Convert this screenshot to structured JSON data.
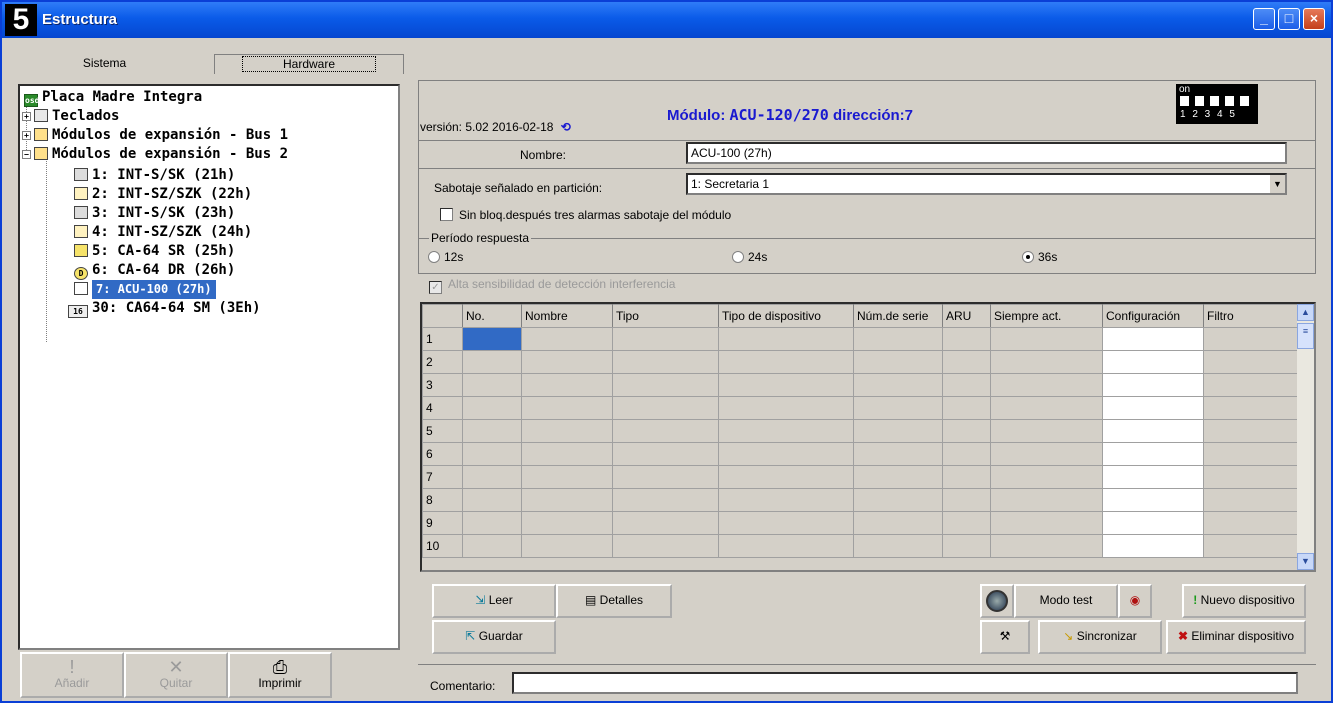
{
  "window": {
    "app_number": "5",
    "title": "Estructura",
    "minimize": "_",
    "maximize": "□",
    "close": "×"
  },
  "tabs": [
    {
      "label": "Sistema"
    },
    {
      "label": "Hardware"
    }
  ],
  "tree": {
    "root": "Placa Madre Integra",
    "root_icon_text": "osd",
    "items": [
      {
        "label": "Teclados",
        "pm": "+"
      },
      {
        "label": "Módulos de expansión - Bus 1",
        "pm": "+"
      },
      {
        "label": "Módulos de expansión - Bus 2",
        "pm": "−"
      }
    ],
    "bus2_children": [
      {
        "label": "1: INT-S/SK (21h)"
      },
      {
        "label": "2: INT-SZ/SZK (22h)"
      },
      {
        "label": "3: INT-S/SK (23h)"
      },
      {
        "label": "4: INT-SZ/SZK (24h)"
      },
      {
        "label": "5: CA-64 SR (25h)"
      },
      {
        "label": "6: CA-64 DR (26h)"
      },
      {
        "label": "7: ACU-100 (27h)"
      },
      {
        "label": "30: CA64-64 SM (3Eh)"
      }
    ],
    "icon_d": "D",
    "icon_16": "16"
  },
  "left_buttons": {
    "add": "Añadir",
    "remove": "Quitar",
    "print": "Imprimir"
  },
  "module": {
    "version": "versión: 5.02 2016-02-18",
    "heading_prefix": "Módulo:",
    "model": "ACU-120/270",
    "address": "dirección:7",
    "dip_on": "on",
    "dip_numbers": "1 2 3 4 5"
  },
  "form": {
    "name_label": "Nombre:",
    "name_value": "ACU-100 (27h)",
    "tamper_label": "Sabotaje señalado en partición:",
    "tamper_value": "1: Secretaria 1",
    "no_lock_label": "Sin bloq.después tres alarmas sabotaje del módulo",
    "period_label": "Período respuesta",
    "period_options": [
      {
        "label": "12s",
        "checked": false
      },
      {
        "label": "24s",
        "checked": false
      },
      {
        "label": "36s",
        "checked": true
      }
    ],
    "high_sensitivity_label": "Alta sensibilidad de detección interferencia",
    "high_sensitivity_checked": true
  },
  "grid": {
    "columns": [
      "No.",
      "Nombre",
      "Tipo",
      "Tipo de dispositivo",
      "Núm.de serie",
      "ARU",
      "Siempre act.",
      "Configuración",
      "Filtro"
    ],
    "rows": [
      "1",
      "2",
      "3",
      "4",
      "5",
      "6",
      "7",
      "8",
      "9",
      "10"
    ]
  },
  "actions": {
    "read": "Leer",
    "details": "Detalles",
    "save": "Guardar",
    "test_mode": "Modo test",
    "new_device": "Nuevo dispositivo",
    "sync": "Sincronizar",
    "delete_device": "Eliminar dispositivo"
  },
  "comment_label": "Comentario:",
  "colors": {
    "titlebar": "#0a5be8",
    "selection": "#316ac5",
    "module_text": "#1a1ad0",
    "window_bg": "#d4d0c8"
  }
}
